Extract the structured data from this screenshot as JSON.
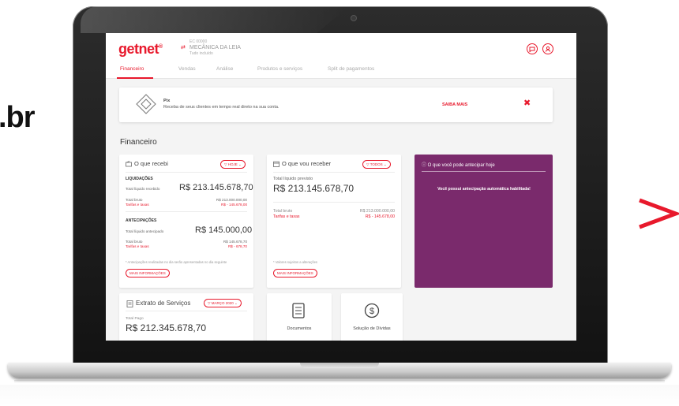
{
  "side_text": ".br",
  "app": {
    "brand": "getnet",
    "brand_mark": "®",
    "merchant": {
      "label_top": "EC 00000",
      "name": "MECÂNICA DA LEIA",
      "label_bottom": "Tudo incluído"
    }
  },
  "tabs": [
    {
      "label": "Financeiro",
      "active": true
    },
    {
      "label": "Vendas",
      "active": false
    },
    {
      "label": "Análise",
      "active": false
    },
    {
      "label": "Produtos e serviços",
      "active": false
    },
    {
      "label": "Split de pagamentos",
      "active": false
    }
  ],
  "pix_banner": {
    "title": "Pix",
    "description": "Receba de seus clientes em tempo real direto na sua conta.",
    "cta": "SAIBA MAIS",
    "close": "✖"
  },
  "section_title": "Financeiro",
  "recebi": {
    "title": "O que recebi",
    "filter": "HOJE",
    "liquidacoes": {
      "heading": "LIQUIDAÇÕES",
      "total_label": "Total líquido recebido",
      "total_value": "R$ 213.145.678,70",
      "bruto_label": "Total bruto",
      "bruto_value": "R$ 213.000.000,00",
      "tarifas_label": "Tarifas e taxas",
      "tarifas_value": "R$ - 145.678,00"
    },
    "antecipacoes": {
      "heading": "ANTECIPAÇÕES",
      "total_label": "Total líquido antecipado",
      "total_value": "R$ 145.000,00",
      "bruto_label": "Total bruto",
      "bruto_value": "R$ 145.678,70",
      "tarifas_label": "Tarifas e taxas",
      "tarifas_value": "R$ - 678,70"
    },
    "footnote": "* Antecipações realizadas no dia serão apresentadas no dia seguinte",
    "more": "MAIS INFORMAÇÕES"
  },
  "receber": {
    "title": "O que vou receber",
    "filter": "TODOS",
    "previsto_label": "Total líquido previsto",
    "previsto_value": "R$ 213.145.678,70",
    "bruto_label": "Total bruto",
    "bruto_value": "R$ 213.000.000,00",
    "tarifas_label": "Tarifas e taxas",
    "tarifas_value": "R$ - 145.678,00",
    "footnote": "* Valores sujeitos a alterações",
    "more": "MAIS INFORMAÇÕES"
  },
  "antecipar": {
    "title": "O que você pode antecipar hoje",
    "message": "Você possui antecipação automática habilitada!"
  },
  "extrato": {
    "title": "Extrato de Serviços",
    "filter": "MARÇO 2020",
    "total_label": "Total Pago",
    "total_value": "R$ 212.345.678,70"
  },
  "tiles": [
    {
      "label": "Documentos",
      "icon": "document-icon"
    },
    {
      "label": "Solução de Dívidas",
      "icon": "dollar-icon"
    }
  ],
  "colors": {
    "brand_red": "#e8192c",
    "purple": "#7a2a6c",
    "screen_bg": "#f4f4f4"
  }
}
